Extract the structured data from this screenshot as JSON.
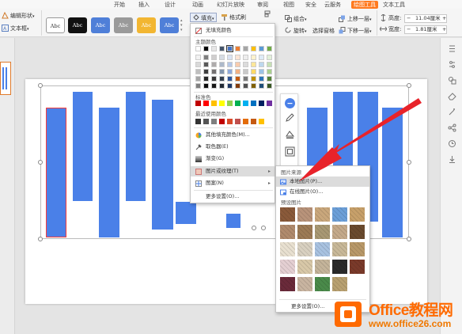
{
  "menu": {
    "tabs": [
      "开始",
      "插入",
      "设计",
      "动画",
      "幻灯片放映",
      "审阅",
      "视图",
      "安全",
      "云服务",
      "绘图工具",
      "文本工具"
    ],
    "active_tab": "绘图工具"
  },
  "ribbon": {
    "edit_shape": "编辑形状",
    "text_box": "文本框",
    "style_swatches": [
      "Abc",
      "Abc",
      "Abc",
      "Abc",
      "Abc",
      "Abc"
    ],
    "fill": "填充",
    "format_brush": "格式刷",
    "group": "组合",
    "rotate": "旋转",
    "selection_pane": "选择窗格",
    "bring_forward": "上移一层",
    "send_backward": "下移一层",
    "height_label": "高度:",
    "height_value": "11.04厘米",
    "width_label": "宽度:",
    "width_value": "1.81厘米",
    "minus": "−",
    "plus": "+"
  },
  "fill_menu": {
    "no_fill": "无填充颜色",
    "theme_colors": "主题颜色",
    "standard_colors": "标准色",
    "recent_colors": "最近使用颜色",
    "more_fill_colors": "其他填充颜色(M)...",
    "eyedropper": "取色器(E)",
    "gradient": "渐变(G)",
    "picture_texture": "图片或纹理(T)",
    "pattern": "图案(N)",
    "more_settings": "更多设置(O)..."
  },
  "texture_menu": {
    "picture_source": "图片来源",
    "local_picture": "本地图片(P)...",
    "online_picture": "在线图片(O)...",
    "preset_pictures": "预设图片",
    "more_settings": "更多设置(O)..."
  },
  "watermark": {
    "name": "Office教程网",
    "url": "www.office26.com"
  },
  "colors": {
    "accent": "#ff7a1f",
    "bar_blue": "#4a80e8",
    "arrow_red": "#e8232a"
  }
}
